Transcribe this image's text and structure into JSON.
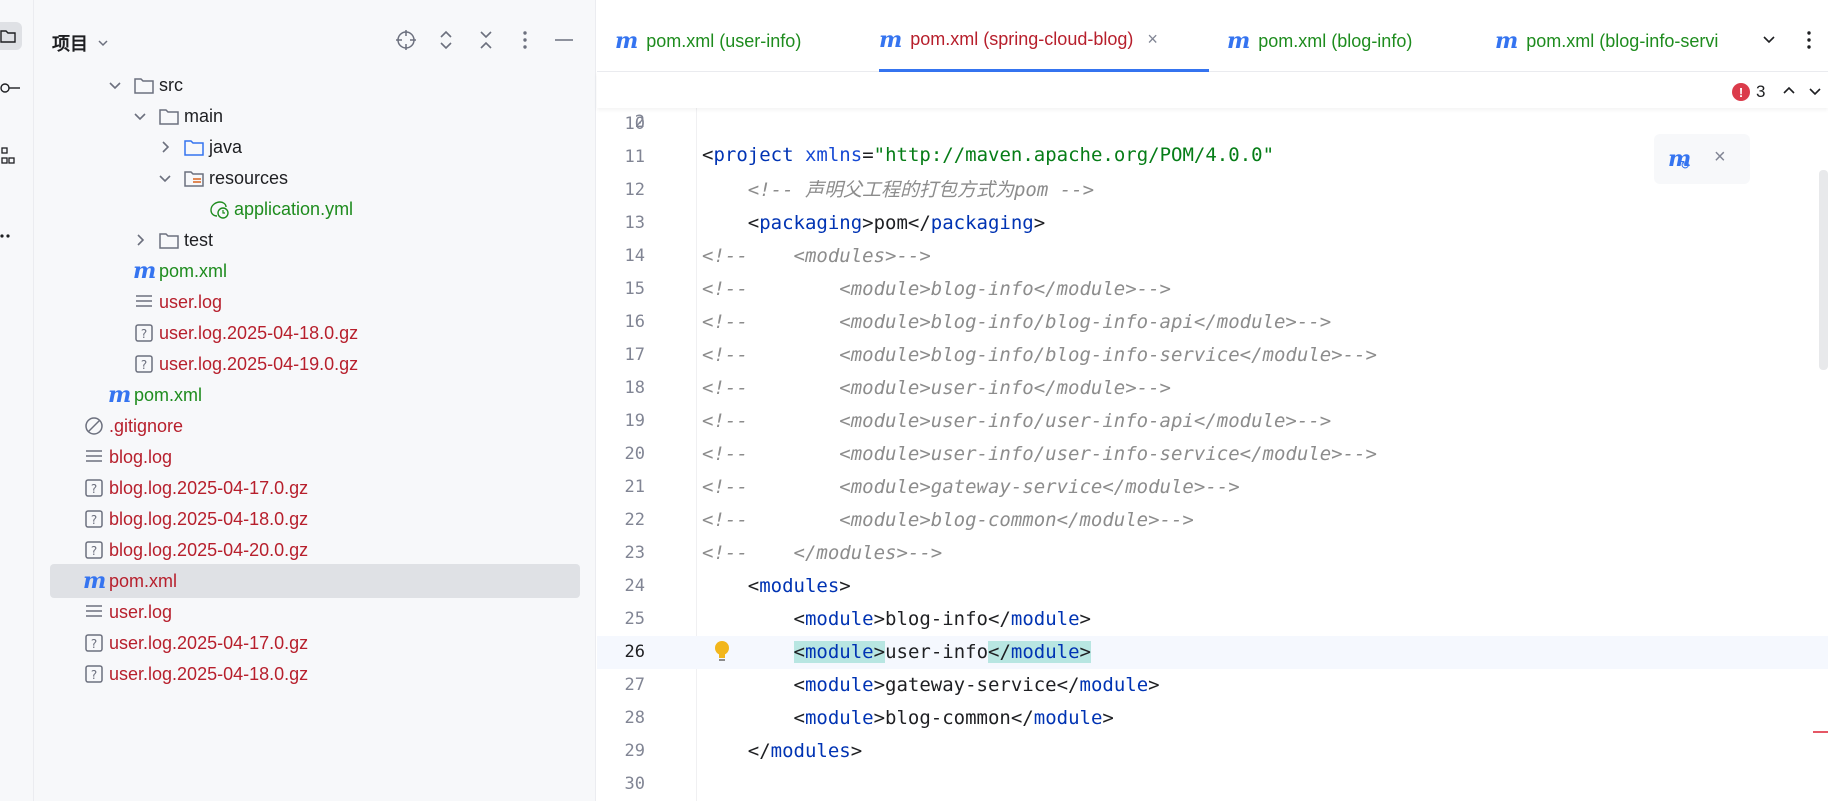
{
  "project_panel": {
    "title": "项目",
    "tree": [
      {
        "label": "src",
        "type": "folder",
        "expanded": true,
        "color": "dark"
      },
      {
        "label": "main",
        "type": "folder",
        "expanded": true,
        "color": "dark"
      },
      {
        "label": "java",
        "type": "source-folder",
        "expanded": false,
        "color": "dark"
      },
      {
        "label": "resources",
        "type": "resources-folder",
        "expanded": true,
        "color": "dark"
      },
      {
        "label": "application.yml",
        "type": "yml-file",
        "color": "green"
      },
      {
        "label": "test",
        "type": "folder",
        "expanded": false,
        "color": "dark"
      },
      {
        "label": "pom.xml",
        "type": "maven-file",
        "color": "green"
      },
      {
        "label": "user.log",
        "type": "text-file",
        "color": "red"
      },
      {
        "label": "user.log.2025-04-18.0.gz",
        "type": "unknown-file",
        "color": "red"
      },
      {
        "label": "user.log.2025-04-19.0.gz",
        "type": "unknown-file",
        "color": "red"
      },
      {
        "label": "pom.xml",
        "type": "maven-file",
        "color": "green"
      },
      {
        "label": ".gitignore",
        "type": "ignored-file",
        "color": "red"
      },
      {
        "label": "blog.log",
        "type": "text-file",
        "color": "red"
      },
      {
        "label": "blog.log.2025-04-17.0.gz",
        "type": "unknown-file",
        "color": "red"
      },
      {
        "label": "blog.log.2025-04-18.0.gz",
        "type": "unknown-file",
        "color": "red"
      },
      {
        "label": "blog.log.2025-04-20.0.gz",
        "type": "unknown-file",
        "color": "red"
      },
      {
        "label": "pom.xml",
        "type": "maven-file",
        "color": "red",
        "selected": true
      },
      {
        "label": "user.log",
        "type": "text-file",
        "color": "red"
      },
      {
        "label": "user.log.2025-04-17.0.gz",
        "type": "unknown-file",
        "color": "red"
      },
      {
        "label": "user.log.2025-04-18.0.gz",
        "type": "unknown-file",
        "color": "red"
      }
    ]
  },
  "tabs": [
    {
      "label": "pom.xml (user-info)",
      "active": false
    },
    {
      "label": "pom.xml (spring-cloud-blog)",
      "active": true
    },
    {
      "label": "pom.xml (blog-info)",
      "active": false
    },
    {
      "label": "pom.xml (blog-info-servi",
      "active": false
    }
  ],
  "tab_close_glyph": "×",
  "editor": {
    "error_count": "3",
    "sticky_line": {
      "num": "2",
      "code": "<project xmlns=\"http://maven.apache.org/POM/4.0.0\""
    },
    "current_line": "26",
    "lines": [
      {
        "num": "10",
        "code": ""
      },
      {
        "num": "11",
        "code": ""
      },
      {
        "num": "12",
        "code": "    <!-- 声明父工程的打包方式为pom -->"
      },
      {
        "num": "13",
        "code": "    <packaging>pom</packaging>"
      },
      {
        "num": "14",
        "code": "<!--    <modules>-->"
      },
      {
        "num": "15",
        "code": "<!--        <module>blog-info</module>-->"
      },
      {
        "num": "16",
        "code": "<!--        <module>blog-info/blog-info-api</module>-->"
      },
      {
        "num": "17",
        "code": "<!--        <module>blog-info/blog-info-service</module>-->"
      },
      {
        "num": "18",
        "code": "<!--        <module>user-info</module>-->"
      },
      {
        "num": "19",
        "code": "<!--        <module>user-info/user-info-api</module>-->"
      },
      {
        "num": "20",
        "code": "<!--        <module>user-info/user-info-service</module>-->"
      },
      {
        "num": "21",
        "code": "<!--        <module>gateway-service</module>-->"
      },
      {
        "num": "22",
        "code": "<!--        <module>blog-common</module>-->"
      },
      {
        "num": "23",
        "code": "<!--    </modules>-->"
      },
      {
        "num": "24",
        "code": "    <modules>"
      },
      {
        "num": "25",
        "code": "        <module>blog-info</module>"
      },
      {
        "num": "26",
        "code": "        <module>user-info</module>"
      },
      {
        "num": "27",
        "code": "        <module>gateway-service</module>"
      },
      {
        "num": "28",
        "code": "        <module>blog-common</module>"
      },
      {
        "num": "29",
        "code": "    </modules>"
      },
      {
        "num": "30",
        "code": ""
      }
    ]
  },
  "colors": {
    "accent": "#3574f0",
    "tag": "#0033b3",
    "string": "#067d17",
    "comment": "#8c8c8c",
    "file_red": "#b71f2c",
    "file_green": "#1e8c1e",
    "error": "#db3b4b"
  }
}
